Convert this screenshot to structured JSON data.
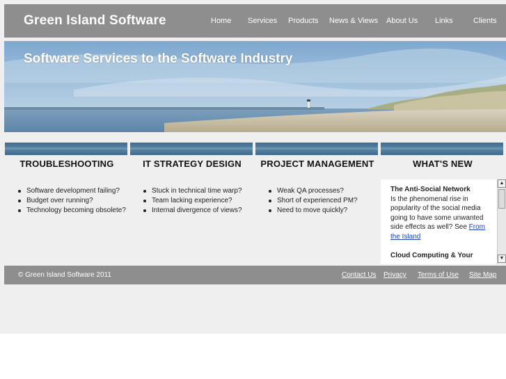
{
  "header": {
    "site_title": "Green Island Software",
    "nav": [
      "Home",
      "Services",
      "Products",
      "News & Views",
      "About Us",
      "Links",
      "Clients"
    ]
  },
  "banner": {
    "tagline": "Software Services to the Software Industry"
  },
  "columns": [
    {
      "title": "TROUBLESHOOTING",
      "items": [
        "Software development failing?",
        "Budget over running?",
        "Technology becoming obsolete?"
      ]
    },
    {
      "title": "IT STRATEGY DESIGN",
      "items": [
        "Stuck in technical time warp?",
        "Team lacking experience?",
        "Internal divergence of views?"
      ]
    },
    {
      "title": "PROJECT MANAGEMENT",
      "items": [
        "Weak QA processes?",
        "Short of experienced PM?",
        "Need to move quickly?"
      ]
    },
    {
      "title": "WHAT'S NEW",
      "items": []
    }
  ],
  "news": {
    "item1_title": "The Anti-Social Network",
    "item1_body": "Is the phenomenal rise in popularity of the social media going to have some unwanted side effects as well?  See ",
    "item1_link": "From the Island",
    "item2_title": "Cloud Computing & Your"
  },
  "footer": {
    "copyright": "© Green Island Software 2011",
    "links": [
      "Contact Us",
      "Privacy",
      "Terms of Use",
      "Site Map"
    ]
  },
  "colors": {
    "header_gray": "#8e8e8e",
    "strip_blue": "#4a7397",
    "link_blue": "#1a3fb8"
  }
}
